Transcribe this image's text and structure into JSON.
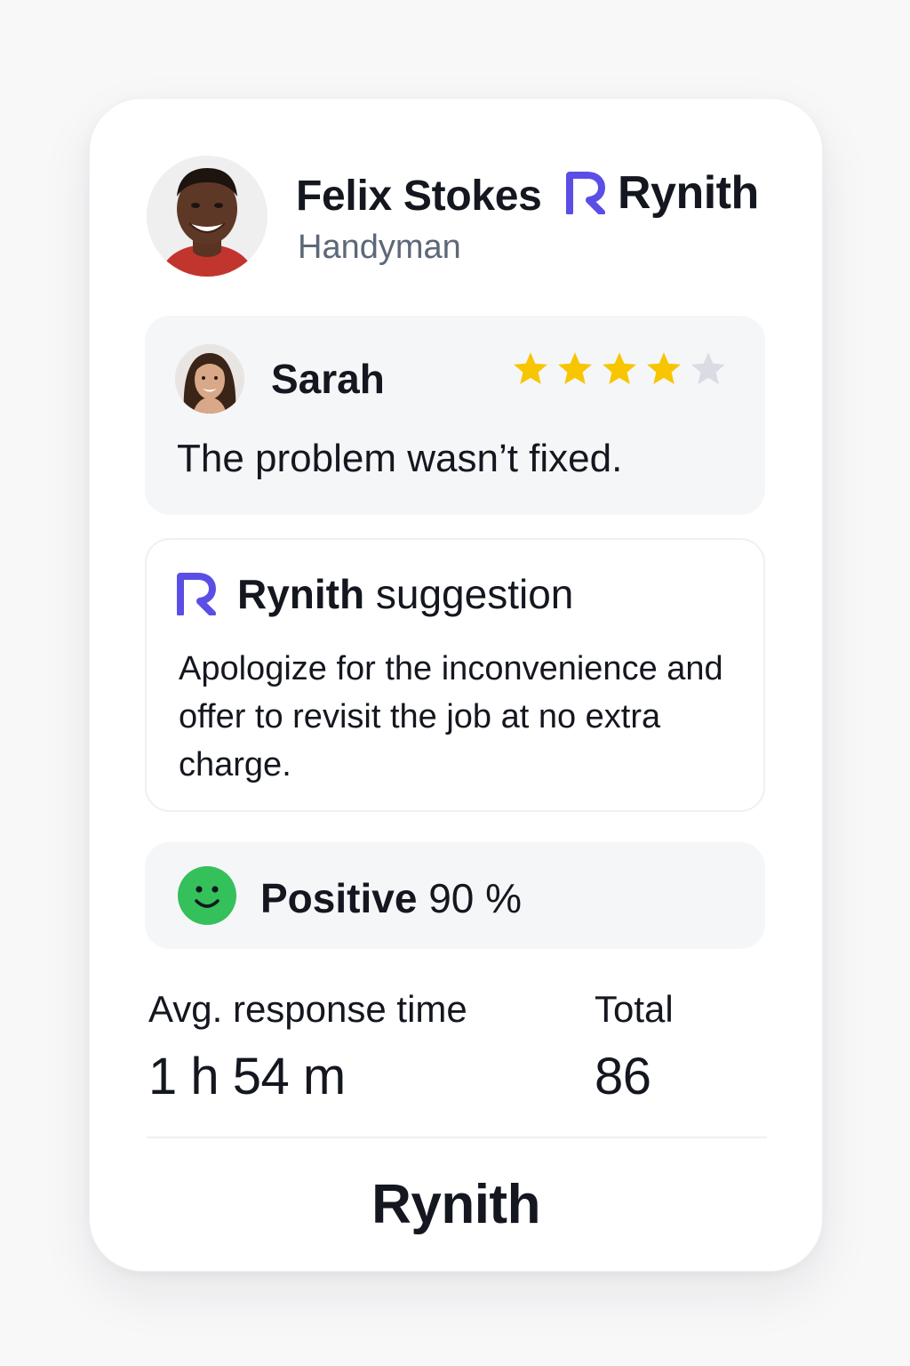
{
  "header": {
    "worker_name": "Felix Stokes",
    "worker_role": "Handyman",
    "brand_name": "Rynith"
  },
  "review": {
    "reviewer_name": "Sarah",
    "rating": 4,
    "rating_max": 5,
    "text": "The problem wasn’t fixed."
  },
  "suggestion": {
    "brand_label": "Rynith",
    "title_suffix": "suggestion",
    "text": "Apologize for the inconvenience and offer to revisit the job at no extra charge."
  },
  "sentiment": {
    "label": "Positive",
    "value": "90 %"
  },
  "stats": {
    "response_label": "Avg. response time",
    "response_value": "1 h 54 m",
    "total_label": "Total",
    "total_value": "86"
  },
  "footer": {
    "brand_name": "Rynith"
  },
  "colors": {
    "brand_accent": "#5b4ee6",
    "star_filled": "#f7c600",
    "star_empty": "#d9dce2",
    "positive_green": "#34c05a"
  },
  "icons": {
    "brand": "rynith-logo-icon",
    "rating": "star-icon",
    "sentiment": "smiley-face-icon"
  }
}
